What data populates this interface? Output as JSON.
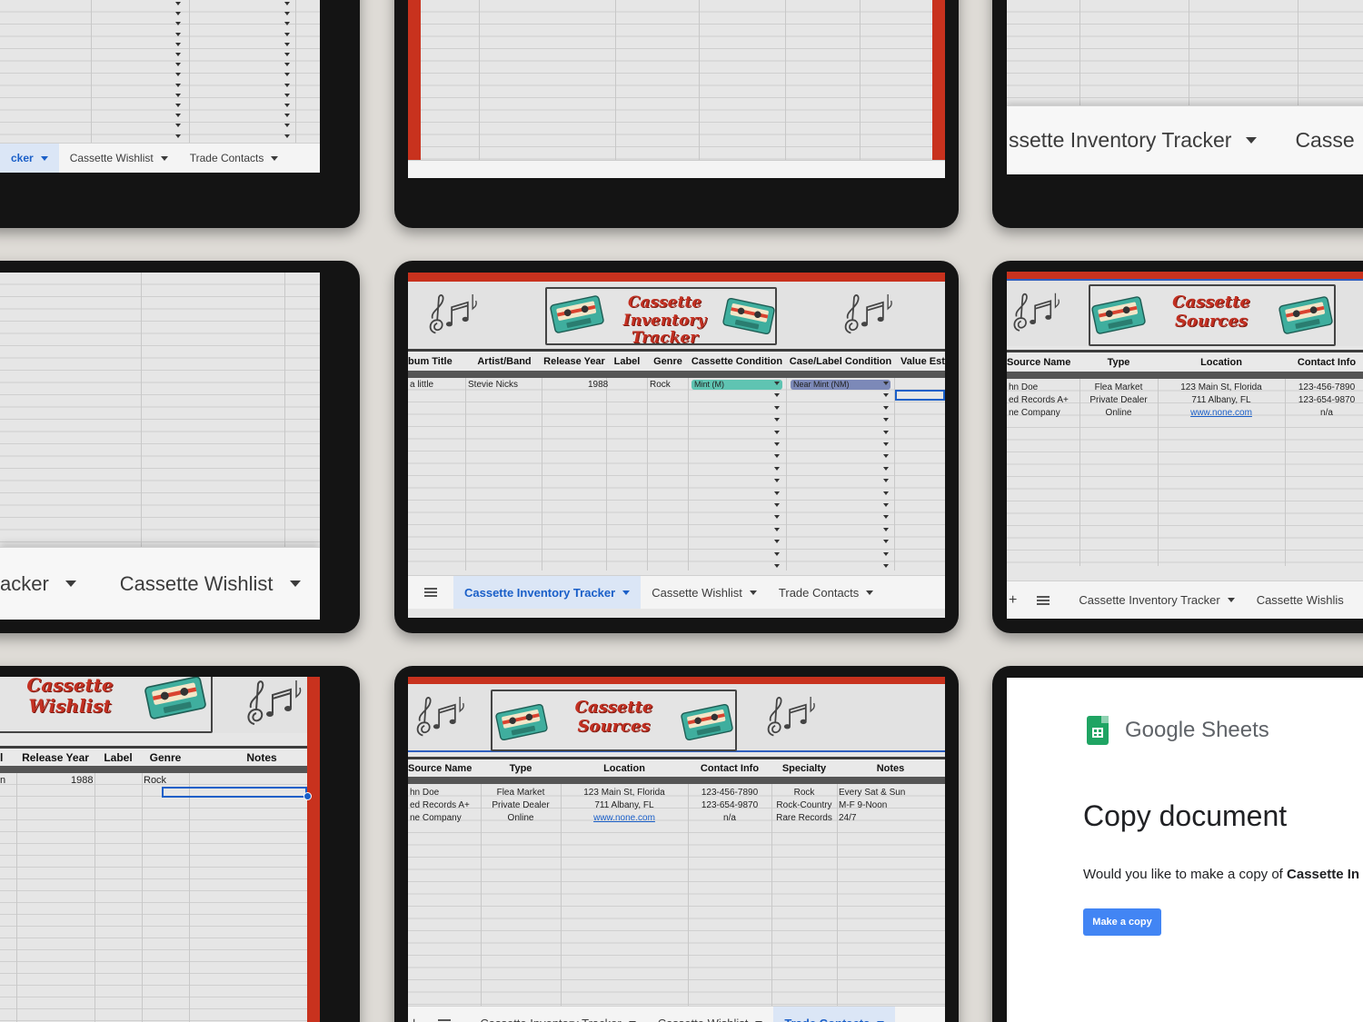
{
  "tabs": {
    "inventory": "Cassette Inventory Tracker",
    "inventory_left_crop": "cker",
    "inventory_big_crop": "acker",
    "inventory_right_crop": "ssette Inventory Tracker",
    "inventory_right_crop2": "Casse",
    "wishlist": "Cassette Wishlist",
    "wishlist_crop": "Cassette Wishlis",
    "trade": "Trade Contacts"
  },
  "banners": {
    "inventory": [
      "Cassette",
      "Inventory Tracker"
    ],
    "sources": [
      "Cassette",
      "Sources"
    ],
    "wishlist": [
      "Cassette",
      "Wishlist"
    ]
  },
  "inventory": {
    "headers": [
      "bum Title",
      "Artist/Band",
      "Release Year",
      "Label",
      "Genre",
      "Cassette Condition",
      "Case/Label Condition",
      "Value Est"
    ],
    "row": [
      "a little",
      "Stevie Nicks",
      "1988",
      "",
      "Rock",
      "Mint (M)",
      "Near Mint (NM)"
    ]
  },
  "sources": {
    "headers": [
      "Source Name",
      "Type",
      "Location",
      "Contact Info",
      "Specialty",
      "Notes"
    ],
    "rows_crop": [
      [
        "hn Doe",
        "Flea Market",
        "123 Main St, Florida",
        "123-456-7890"
      ],
      [
        "ed Records A+",
        "Private Dealer",
        "711 Albany, FL",
        "123-654-9870"
      ],
      [
        "ne Company",
        "Online",
        "www.none.com",
        "n/a"
      ]
    ],
    "rows_full": [
      [
        "hn Doe",
        "Flea Market",
        "123 Main St, Florida",
        "123-456-7890",
        "Rock",
        "Every Sat & Sun"
      ],
      [
        "ed Records A+",
        "Private Dealer",
        "711 Albany, FL",
        "123-654-9870",
        "Rock-Country",
        "M-F 9-Noon"
      ],
      [
        "ne Company",
        "Online",
        "www.none.com",
        "n/a",
        "Rare Records",
        "24/7"
      ]
    ]
  },
  "wishlist": {
    "headers": [
      "l",
      "Release Year",
      "Label",
      "Genre",
      "Notes"
    ],
    "row": [
      "n",
      "1988",
      "",
      "Rock"
    ]
  },
  "copy_dialog": {
    "brand": "Google Sheets",
    "heading": "Copy document",
    "question": "Would you like to make a copy of ",
    "doc_name": "Cassette In",
    "button": "Make a copy"
  },
  "colors": {
    "accent_red": "#c8321e",
    "sheets_blue": "#1a5fc8",
    "tape_teal": "#3fae9e"
  }
}
